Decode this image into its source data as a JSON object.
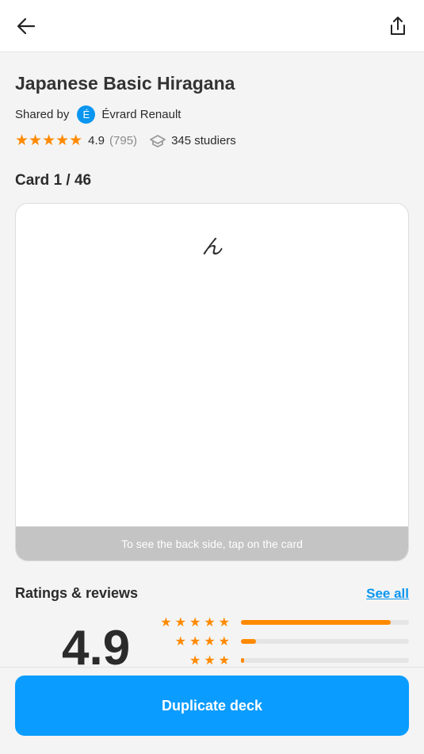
{
  "deck": {
    "title": "Japanese Basic Hiragana",
    "shared_by_label": "Shared by",
    "author_initial": "É",
    "author": "Évrard Renault",
    "rating": "4.9",
    "rating_count": "(795)",
    "studiers": "345 studiers",
    "stars": "★★★★★"
  },
  "card": {
    "label": "Card 1 / 46",
    "front": "ん",
    "hint": "To see the back side, tap on the card"
  },
  "ratings": {
    "heading": "Ratings & reviews",
    "see_all": "See all",
    "average": "4.9",
    "distribution": [
      {
        "stars": "★★★★★",
        "fraction": 0.89
      },
      {
        "stars": "★★★★",
        "fraction": 0.09
      },
      {
        "stars": "★★★",
        "fraction": 0.01
      }
    ]
  },
  "footer": {
    "duplicate_label": "Duplicate deck"
  },
  "colors": {
    "accent": "#0a9cff",
    "star": "#ff8a00"
  }
}
